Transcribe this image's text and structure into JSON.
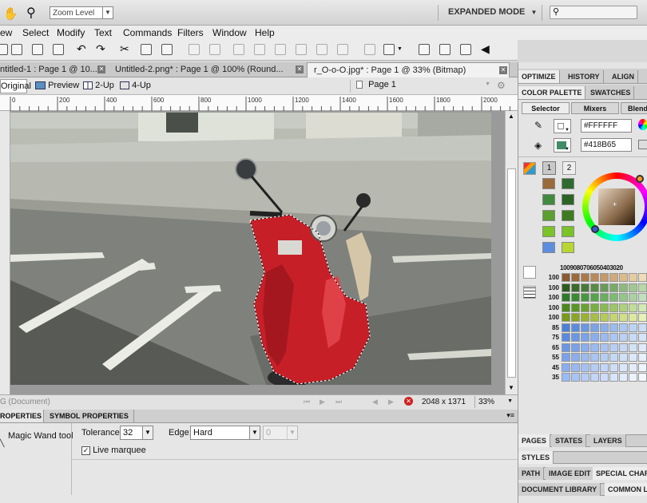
{
  "topbar": {
    "zoom_level": "Zoom Level",
    "mode": "EXPANDED MODE",
    "search_placeholder": ""
  },
  "menu": [
    "ew",
    "Select",
    "Modify",
    "Text",
    "Commands",
    "Filters",
    "Window",
    "Help"
  ],
  "doc_tabs": [
    {
      "label": "ntitled-1 : Page 1 @ 10...",
      "active": false
    },
    {
      "label": "Untitled-2.png* : Page 1 @ 100% (Round...",
      "active": false
    },
    {
      "label": "r_O-o-O.jpg* : Page 1 @ 33% (Bitmap)",
      "active": true
    }
  ],
  "views": {
    "original": "Original",
    "preview": "Preview",
    "two_up": "2-Up",
    "four_up": "4-Up",
    "page": "Page 1"
  },
  "ruler_ticks": [
    "0",
    "200",
    "400",
    "600",
    "800",
    "1000",
    "1200",
    "1400",
    "1600",
    "1800",
    "2000"
  ],
  "status": {
    "doc": "G (Document)",
    "dimensions": "2048 x 1371",
    "zoom": "33%"
  },
  "properties": {
    "tabs": [
      "ROPERTIES",
      "SYMBOL PROPERTIES"
    ],
    "tool_name": "Magic Wand tool",
    "tolerance_label": "Tolerance:",
    "tolerance_value": "32",
    "edge_label": "Edge:",
    "edge_value": "Hard",
    "feather_value": "0",
    "live_marquee_label": "Live marquee",
    "live_marquee_checked": true
  },
  "panel": {
    "top_tabs": [
      "OPTIMIZE",
      "HISTORY",
      "ALIGN"
    ],
    "color_tabs": [
      "COLOR PALETTE",
      "SWATCHES"
    ],
    "sub_tabs": [
      "Selector",
      "Mixers",
      "Blend"
    ],
    "stroke_hex": "#FFFFFF",
    "fill_hex": "#418B65",
    "mode_buttons": [
      "1",
      "2"
    ],
    "grid_header": [
      "100",
      "90",
      "80",
      "70",
      "60",
      "50",
      "40",
      "30",
      "20"
    ],
    "grid_rows": [
      "100",
      "100",
      "100",
      "100",
      "100",
      "85",
      "75",
      "65",
      "55",
      "45",
      "35"
    ],
    "bottom_tabs": [
      [
        "PAGES",
        "STATES",
        "LAYERS"
      ],
      [
        "STYLES"
      ],
      [
        "PATH",
        "IMAGE EDIT",
        "SPECIAL CHAR"
      ],
      [
        "DOCUMENT LIBRARY",
        "COMMON LI"
      ]
    ]
  },
  "colors": {
    "accent": "#418B65",
    "stroke": "#FFFFFF",
    "scooter": "#C8202A"
  }
}
